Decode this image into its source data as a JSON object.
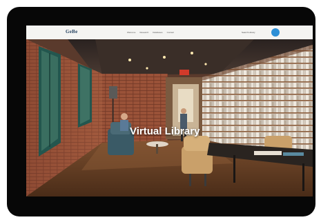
{
  "site": {
    "logo_text": "GeBe",
    "nav_links": [
      "Welcome",
      "Research",
      "Databases",
      "Contact"
    ],
    "contact_link": "Search Library",
    "accent_color": "#2d8fd6"
  },
  "hero": {
    "title": "Virtual Library"
  },
  "icons": {
    "nav_button": "circle-button-icon"
  }
}
